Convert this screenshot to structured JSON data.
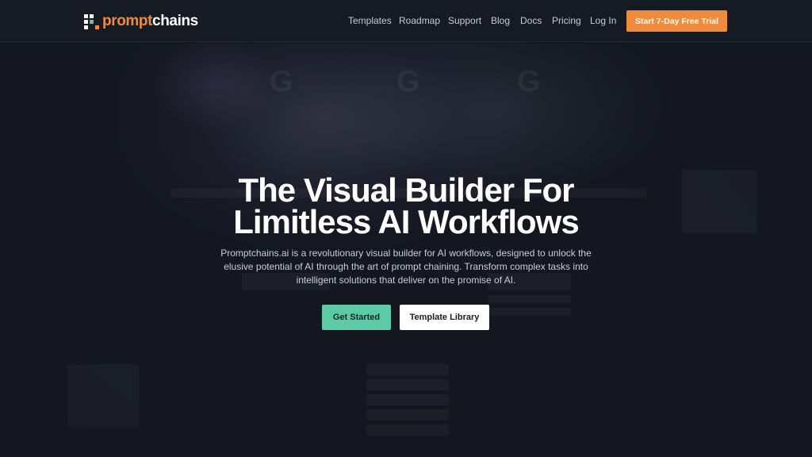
{
  "brand": {
    "name_part1": "prompt",
    "name_part2": "chains",
    "logo_icon": "pixel-blocks-logo",
    "accent_color": "#f08a3c"
  },
  "nav": {
    "items": [
      "Templates",
      "Roadmap",
      "Support",
      "Blog",
      "Docs",
      "Pricing"
    ],
    "login_label": "Log In",
    "trial_label": "Start 7-Day Free Trial"
  },
  "hero": {
    "title_line1": "The Visual Builder For",
    "title_line2": "Limitless AI Workflows",
    "description": "Promptchains.ai is a revolutionary visual builder for AI workflows, designed to unlock the elusive potential of AI through the art of prompt chaining. Transform complex tasks into intelligent solutions that deliver on the promise of AI.",
    "primary_button": "Get Started",
    "secondary_button": "Template Library"
  },
  "colors": {
    "background": "#141720",
    "primary_button": "#5cc9a7",
    "trial_button": "#f08b3d"
  }
}
